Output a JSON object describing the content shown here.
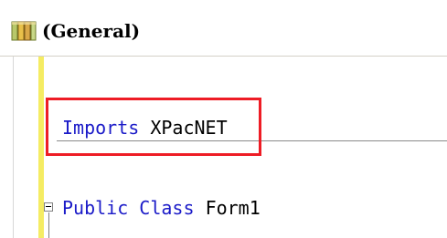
{
  "toolbar": {
    "object_dropdown": {
      "icon": "class-members-icon",
      "value": "(General)"
    }
  },
  "code": {
    "imports_line": {
      "keyword": "Imports",
      "namespace": "XPacNET"
    },
    "class_line": {
      "modifier": "Public",
      "keyword": "Class",
      "name": "Form1"
    }
  },
  "colors": {
    "keyword": "#1a1ac8",
    "highlight_box": "#ee1c25",
    "change_marker": "#f5ec63"
  }
}
